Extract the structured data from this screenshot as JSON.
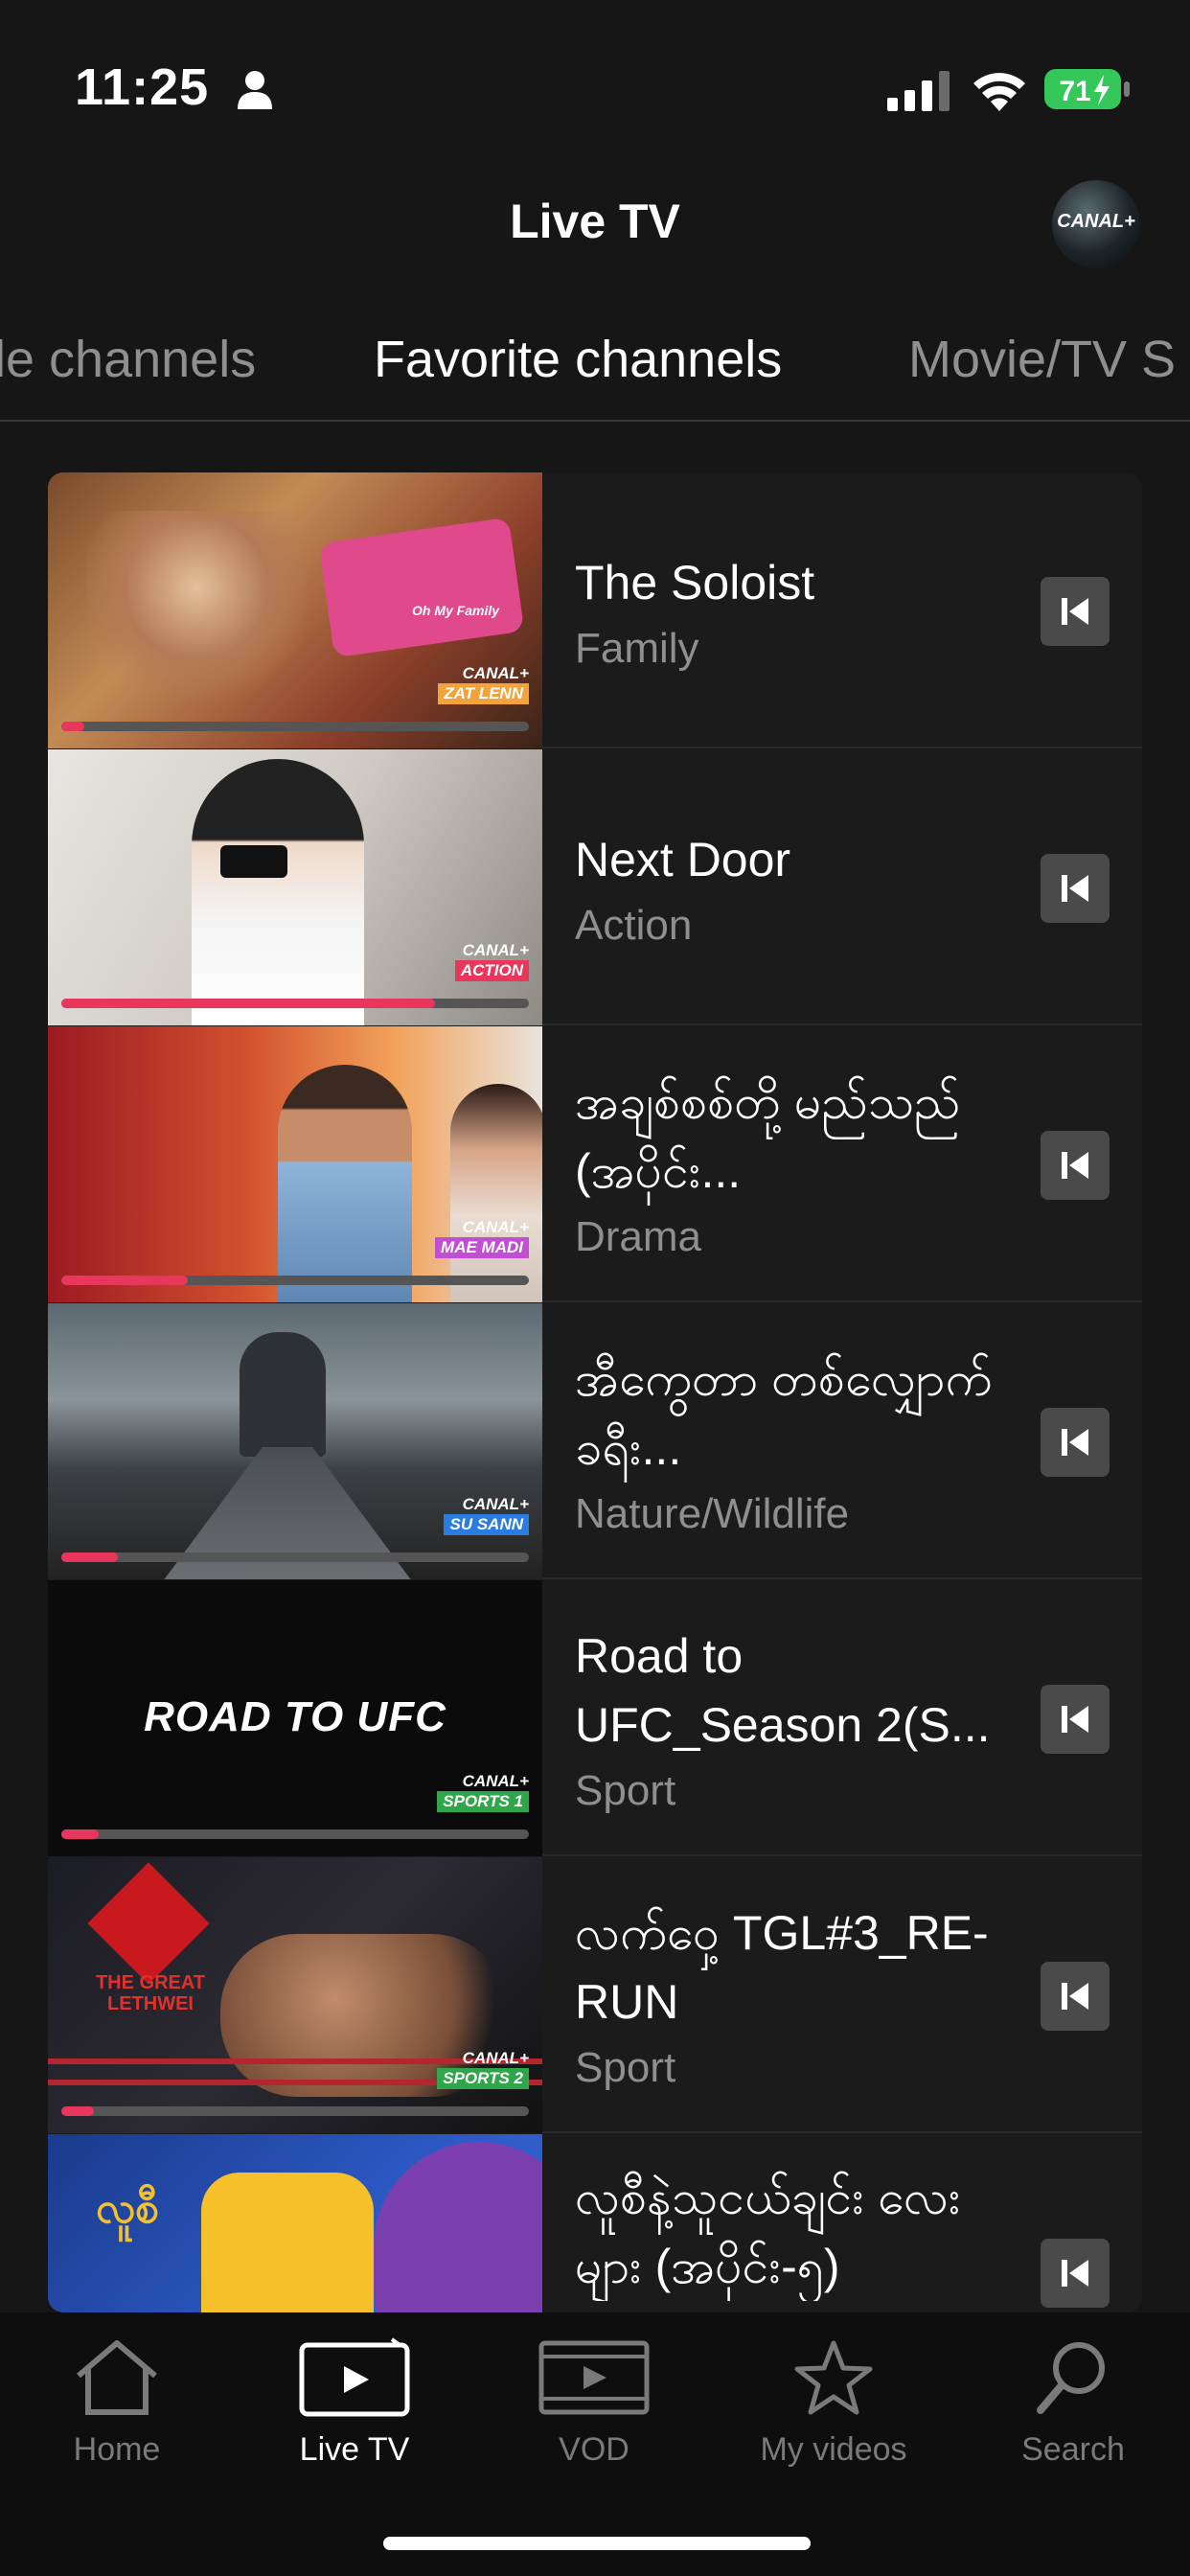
{
  "status_bar": {
    "time": "11:25",
    "battery": "71"
  },
  "header": {
    "title": "Live TV",
    "avatar_text": "CANAL+"
  },
  "tabs": [
    {
      "label": "le channels"
    },
    {
      "label": "Favorite channels"
    },
    {
      "label": "Movie/TV S"
    }
  ],
  "channels": [
    {
      "title": "The Soloist",
      "genre": "Family",
      "logo_channel": "ZAT LENN",
      "logo_brand": "CANAL+",
      "thumb_caption": "Oh My Family",
      "progress": 0.05
    },
    {
      "title": "Next Door",
      "genre": "Action",
      "logo_channel": "ACTION",
      "logo_brand": "CANAL+",
      "progress": 0.8
    },
    {
      "title": "အချစ်စစ်တို့ မည်သည် (အပိုင်း...",
      "genre": "Drama",
      "logo_channel": "MAE MADI",
      "logo_brand": "CANAL+",
      "progress": 0.27
    },
    {
      "title": "အီကွေတာ တစ်လျှောက်ခရီး...",
      "genre": "Nature/Wildlife",
      "logo_channel": "SU SANN",
      "logo_brand": "CANAL+",
      "progress": 0.12
    },
    {
      "title": "Road to UFC_Season 2(S...",
      "genre": "Sport",
      "logo_channel": "SPORTS 1",
      "logo_brand": "CANAL+",
      "thumb_caption": "ROAD TO UFC",
      "progress": 0.08
    },
    {
      "title": "လက်ဝှေ့ TGL#3_RE-RUN",
      "genre": "Sport",
      "logo_channel": "SPORTS 2",
      "logo_brand": "CANAL+",
      "thumb_caption": "THE GREAT LETHWEI",
      "progress": 0.07
    },
    {
      "title": "လူစီနဲ့သူငယ်ချင်း လေးများ (အပိုင်း-၅)",
      "genre": "",
      "logo_channel": "",
      "logo_brand": "",
      "thumb_caption": "လူစီ",
      "progress": 0
    }
  ],
  "bottom_nav": [
    {
      "label": "Home"
    },
    {
      "label": "Live TV"
    },
    {
      "label": "VOD"
    },
    {
      "label": "My videos"
    },
    {
      "label": "Search"
    }
  ],
  "colors": {
    "accent": "#e8365d",
    "background": "#161616",
    "card": "#1b1b1b",
    "muted_text": "#8f8f8f",
    "battery_green": "#35c759"
  }
}
